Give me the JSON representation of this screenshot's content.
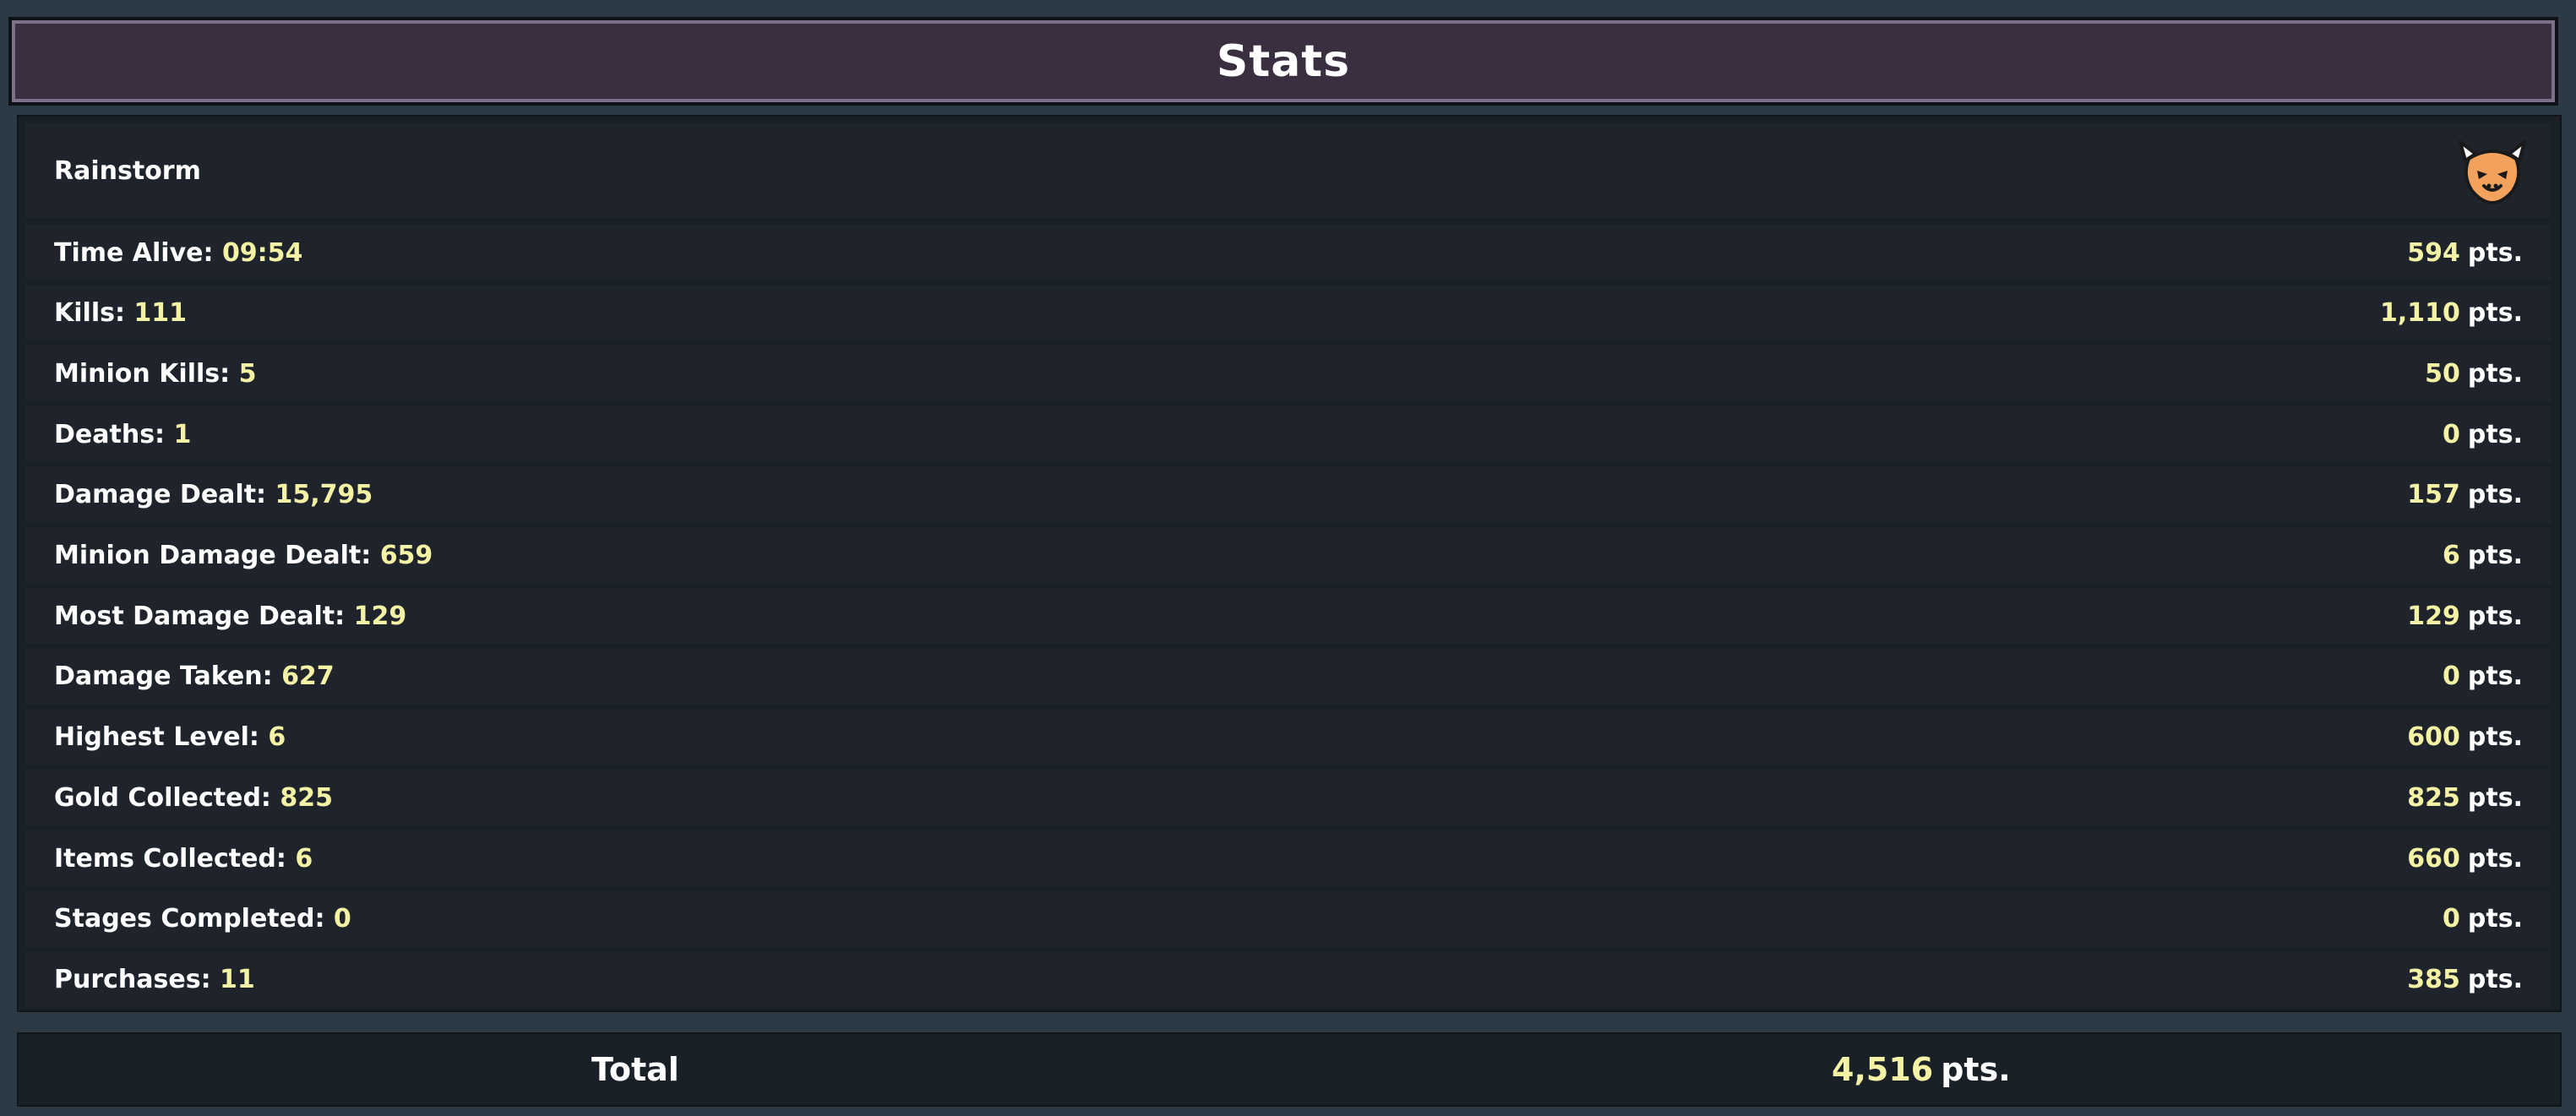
{
  "header": {
    "title": "Stats"
  },
  "player": {
    "name": "Rainstorm",
    "avatar_icon": "horned-beast-mask-icon"
  },
  "stats": [
    {
      "label": "Time Alive:",
      "value": "09:54",
      "points": "594"
    },
    {
      "label": "Kills:",
      "value": "111",
      "points": "1,110"
    },
    {
      "label": "Minion Kills:",
      "value": "5",
      "points": "50"
    },
    {
      "label": "Deaths:",
      "value": "1",
      "points": "0"
    },
    {
      "label": "Damage Dealt:",
      "value": "15,795",
      "points": "157"
    },
    {
      "label": "Minion Damage Dealt:",
      "value": "659",
      "points": "6"
    },
    {
      "label": "Most Damage Dealt:",
      "value": "129",
      "points": "129"
    },
    {
      "label": "Damage Taken:",
      "value": "627",
      "points": "0"
    },
    {
      "label": "Highest Level:",
      "value": "6",
      "points": "600"
    },
    {
      "label": "Gold Collected:",
      "value": "825",
      "points": "825"
    },
    {
      "label": "Items Collected:",
      "value": "6",
      "points": "660"
    },
    {
      "label": "Stages Completed:",
      "value": "0",
      "points": "0"
    },
    {
      "label": "Purchases:",
      "value": "11",
      "points": "385"
    }
  ],
  "pts_unit": "pts.",
  "total": {
    "label": "Total",
    "points": "4,516"
  },
  "colors": {
    "background": "#2c3a45",
    "header_fill": "#392f41",
    "header_border": "#7c7089",
    "value_yellow": "#f4f2a4",
    "avatar_orange": "#f2a25c"
  }
}
